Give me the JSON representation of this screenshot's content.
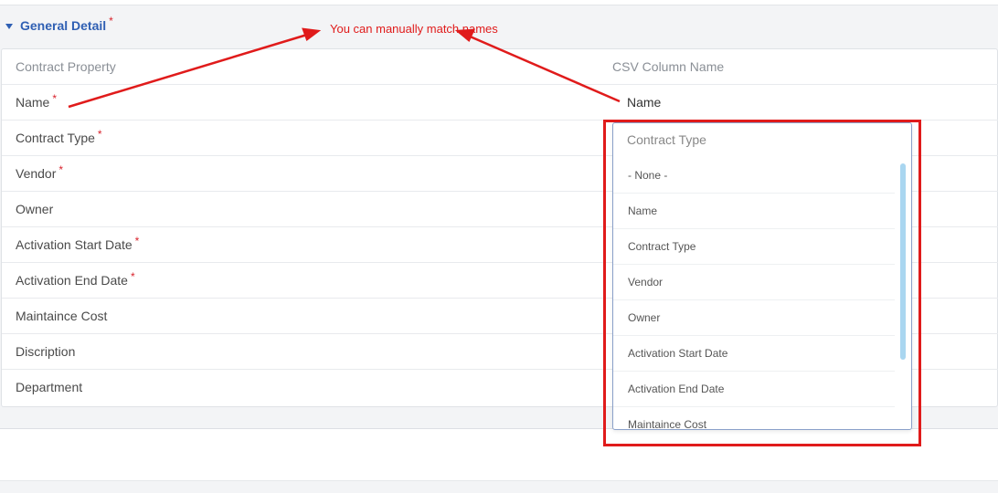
{
  "section": {
    "title": "General Detail",
    "required_mark": "*"
  },
  "annotation": {
    "text": "You can manually match names",
    "color": "#e01b1b"
  },
  "table": {
    "headers": {
      "left": "Contract Property",
      "right": "CSV Column Name"
    },
    "rows": [
      {
        "property": "Name",
        "required": "*",
        "csv": "Name"
      },
      {
        "property": "Contract Type",
        "required": "*",
        "csv": ""
      },
      {
        "property": "Vendor",
        "required": "*",
        "csv": ""
      },
      {
        "property": "Owner",
        "required": "",
        "csv": ""
      },
      {
        "property": "Activation Start Date",
        "required": "*",
        "csv": ""
      },
      {
        "property": "Activation End Date",
        "required": "*",
        "csv": ""
      },
      {
        "property": "Maintaince Cost",
        "required": "",
        "csv": ""
      },
      {
        "property": "Discription",
        "required": "",
        "csv": ""
      },
      {
        "property": "Department",
        "required": "",
        "csv": ""
      }
    ]
  },
  "dropdown": {
    "selected": "Contract Type",
    "options": [
      "- None -",
      "Name",
      "Contract Type",
      "Vendor",
      "Owner",
      "Activation Start Date",
      "Activation End Date",
      "Maintaince Cost"
    ]
  },
  "colors": {
    "accent": "#2f5fb3",
    "required": "#d9232d",
    "annotation": "#e01b1b",
    "scrollbar": "#a9d6f0"
  }
}
